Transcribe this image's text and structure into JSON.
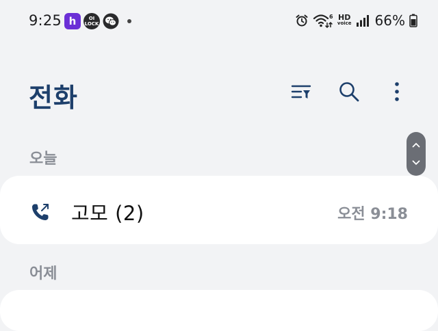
{
  "status_bar": {
    "time": "9:25",
    "notifications": [
      {
        "icon": "app-h-icon",
        "glyph": "h",
        "color": "#6b2fd6"
      },
      {
        "icon": "lock-app-icon",
        "glyph_top": "OI",
        "glyph_bottom": "LOCK"
      },
      {
        "icon": "wechat-icon"
      }
    ],
    "hd_top": "HD",
    "hd_bottom": "voice",
    "wifi_label": "6",
    "battery": "66%"
  },
  "header": {
    "title": "전화"
  },
  "sections": [
    {
      "label": "오늘",
      "calls": [
        {
          "name": "고모 (2)",
          "time": "오전 9:18",
          "type": "outgoing",
          "icon": "outgoing-call-icon"
        }
      ]
    },
    {
      "label": "어제",
      "calls": []
    }
  ],
  "colors": {
    "accent": "#1d3f6b",
    "background": "#f2f3f5",
    "card": "#ffffff",
    "muted_text": "#8a8e96"
  }
}
